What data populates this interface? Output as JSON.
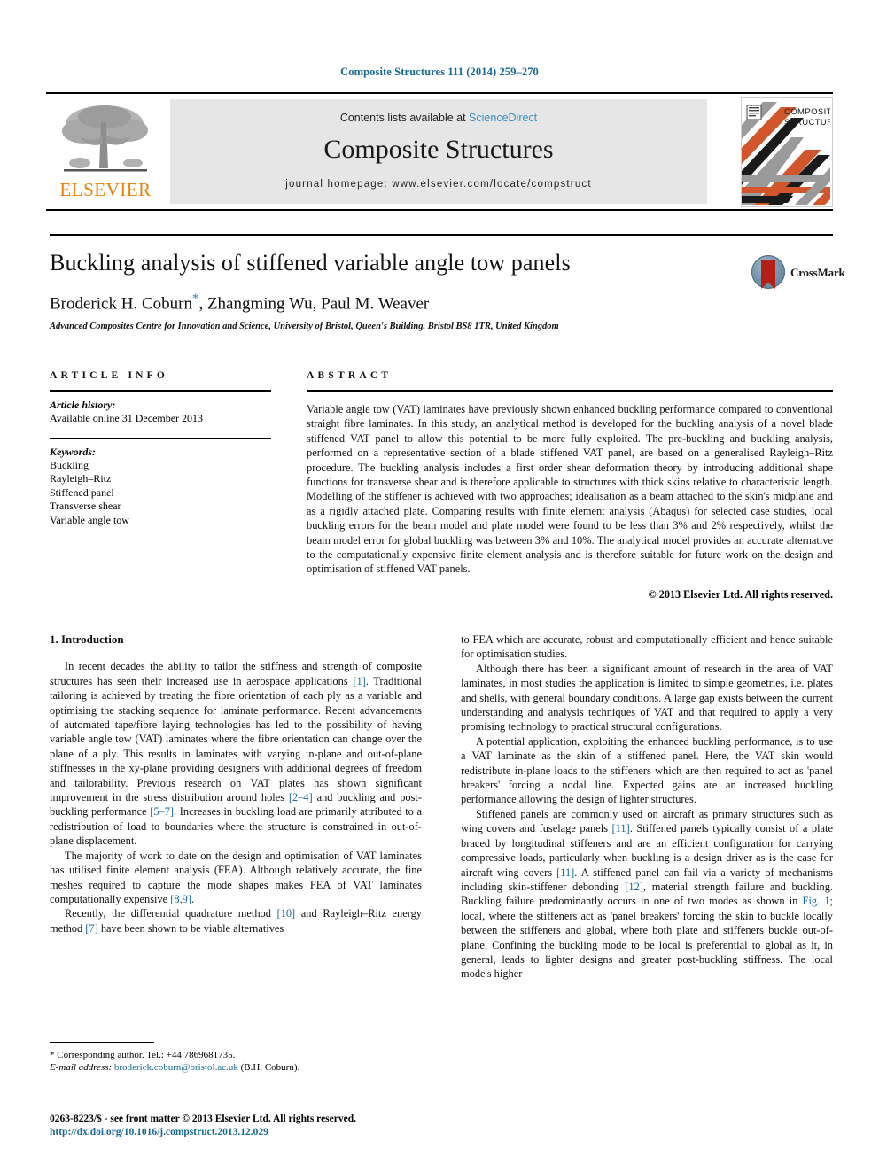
{
  "running_head": "Composite Structures 111 (2014) 259–270",
  "masthead": {
    "publisher_name": "ELSEVIER",
    "contents_prefix": "Contents lists available at ",
    "contents_link": "ScienceDirect",
    "journal_name": "Composite Structures",
    "homepage": "journal homepage: www.elsevier.com/locate/compstruct",
    "cover_title_line1": "COMPOSITE",
    "cover_title_line2": "STRUCTURES"
  },
  "article": {
    "title": "Buckling analysis of stiffened variable angle tow panels",
    "authors": "Broderick H. Coburn",
    "authors_rest": ", Zhangming Wu, Paul M. Weaver",
    "corresponding_marker": "*",
    "affiliation": "Advanced Composites Centre for Innovation and Science, University of Bristol, Queen's Building, Bristol BS8 1TR, United Kingdom",
    "crossmark_label": "CrossMark"
  },
  "article_info": {
    "heading": "ARTICLE INFO",
    "history_label": "Article history:",
    "history_value": "Available online 31 December 2013",
    "keywords_label": "Keywords:",
    "keywords": [
      "Buckling",
      "Rayleigh–Ritz",
      "Stiffened panel",
      "Transverse shear",
      "Variable angle tow"
    ]
  },
  "abstract": {
    "heading": "ABSTRACT",
    "text": "Variable angle tow (VAT) laminates have previously shown enhanced buckling performance compared to conventional straight fibre laminates. In this study, an analytical method is developed for the buckling analysis of a novel blade stiffened VAT panel to allow this potential to be more fully exploited. The pre-buckling and buckling analysis, performed on a representative section of a blade stiffened VAT panel, are based on a generalised Rayleigh–Ritz procedure. The buckling analysis includes a first order shear deformation theory by introducing additional shape functions for transverse shear and is therefore applicable to structures with thick skins relative to characteristic length. Modelling of the stiffener is achieved with two approaches; idealisation as a beam attached to the skin's midplane and as a rigidly attached plate. Comparing results with finite element analysis (Abaqus) for selected case studies, local buckling errors for the beam model and plate model were found to be less than 3% and 2% respectively, whilst the beam model error for global buckling was between 3% and 10%. The analytical model provides an accurate alternative to the computationally expensive finite element analysis and is therefore suitable for future work on the design and optimisation of stiffened VAT panels.",
    "copyright": "© 2013 Elsevier Ltd. All rights reserved."
  },
  "introduction": {
    "heading": "1. Introduction",
    "left_paragraphs": [
      "In recent decades the ability to tailor the stiffness and strength of composite structures has seen their increased use in aerospace applications [1]. Traditional tailoring is achieved by treating the fibre orientation of each ply as a variable and optimising the stacking sequence for laminate performance. Recent advancements of automated tape/fibre laying technologies has led to the possibility of having variable angle tow (VAT) laminates where the fibre orientation can change over the plane of a ply. This results in laminates with varying in-plane and out-of-plane stiffnesses in the xy-plane providing designers with additional degrees of freedom and tailorability. Previous research on VAT plates has shown significant improvement in the stress distribution around holes [2–4] and buckling and post-buckling performance [5–7]. Increases in buckling load are primarily attributed to a redistribution of load to boundaries where the structure is constrained in out-of-plane displacement.",
      "The majority of work to date on the design and optimisation of VAT laminates has utilised finite element analysis (FEA). Although relatively accurate, the fine meshes required to capture the mode shapes makes FEA of VAT laminates computationally expensive [8,9].",
      "Recently, the differential quadrature method [10] and Rayleigh–Ritz energy method [7] have been shown to be viable alternatives"
    ],
    "right_paragraphs": [
      "to FEA which are accurate, robust and computationally efficient and hence suitable for optimisation studies.",
      "Although there has been a significant amount of research in the area of VAT laminates, in most studies the application is limited to simple geometries, i.e. plates and shells, with general boundary conditions. A large gap exists between the current understanding and analysis techniques of VAT and that required to apply a very promising technology to practical structural configurations.",
      "A potential application, exploiting the enhanced buckling performance, is to use a VAT laminate as the skin of a stiffened panel. Here, the VAT skin would redistribute in-plane loads to the stiffeners which are then required to act as 'panel breakers' forcing a nodal line. Expected gains are an increased buckling performance allowing the design of lighter structures.",
      "Stiffened panels are commonly used on aircraft as primary structures such as wing covers and fuselage panels [11]. Stiffened panels typically consist of a plate braced by longitudinal stiffeners and are an efficient configuration for carrying compressive loads, particularly when buckling is a design driver as is the case for aircraft wing covers [11]. A stiffened panel can fail via a variety of mechanisms including skin-stiffener debonding [12], material strength failure and buckling. Buckling failure predominantly occurs in one of two modes as shown in Fig. 1; local, where the stiffeners act as 'panel breakers' forcing the skin to buckle locally between the stiffeners and global, where both plate and stiffeners buckle out-of-plane. Confining the buckling mode to be local is preferential to global as it, in general, leads to lighter designs and greater post-buckling stiffness. The local mode's higher"
    ]
  },
  "footnote": {
    "corresponding": "* Corresponding author. Tel.: +44 7869681735.",
    "email_label": "E-mail address:",
    "email": "broderick.coburn@bristol.ac.uk",
    "email_suffix": " (B.H. Coburn)."
  },
  "footer": {
    "issn_line": "0263-8223/$ - see front matter © 2013 Elsevier Ltd. All rights reserved.",
    "doi": "http://dx.doi.org/10.1016/j.compstruct.2013.12.029"
  },
  "colors": {
    "link": "#1a6a95",
    "sciencedirect": "#3a8fc4",
    "elsevier_orange": "#E8820C",
    "band_grey": "#e6e6e6",
    "cover_orange": "#d1562c",
    "cover_grey": "#9a9a9a",
    "cover_black": "#1a1a1a"
  }
}
